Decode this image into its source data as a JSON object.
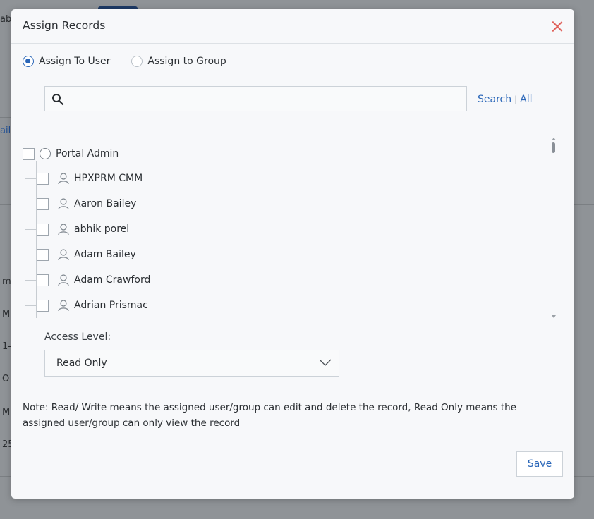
{
  "background": {
    "fragments": [
      "ab",
      "ail",
      "m",
      "M",
      "1-",
      "O",
      "M",
      "25"
    ]
  },
  "modal": {
    "title": "Assign Records",
    "close_icon": "close-icon",
    "assign_options": [
      {
        "label": "Assign To User",
        "selected": true
      },
      {
        "label": "Assign to Group",
        "selected": false
      }
    ],
    "search": {
      "value": "",
      "placeholder": "",
      "search_link": "Search",
      "separator": "|",
      "all_link": "All"
    },
    "tree": {
      "root": {
        "label": "Portal Admin",
        "expanded": true,
        "checked": false
      },
      "users": [
        {
          "label": "HPXPRM CMM",
          "checked": false
        },
        {
          "label": "Aaron Bailey",
          "checked": false
        },
        {
          "label": "abhik porel",
          "checked": false
        },
        {
          "label": "Adam Bailey",
          "checked": false
        },
        {
          "label": "Adam Crawford",
          "checked": false
        },
        {
          "label": "Adrian Prismac",
          "checked": false
        }
      ]
    },
    "access_level": {
      "label": "Access Level:",
      "selected": "Read Only"
    },
    "note": "Note: Read/ Write means the assigned user/group can edit and delete the record, Read Only means the assigned user/group can only view the record",
    "save_label": "Save"
  },
  "colors": {
    "accent": "#2a66b8",
    "close": "#e0625b",
    "overlay": "#8f9397"
  }
}
